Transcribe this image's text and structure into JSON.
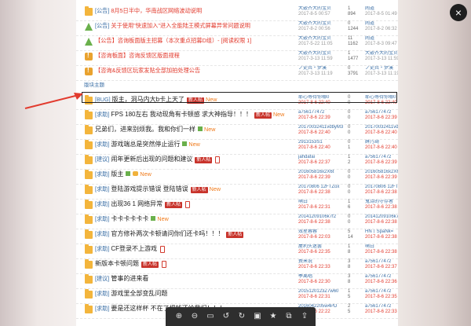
{
  "viewer": {
    "close_label": "×",
    "toolbar_icons": [
      "zoom-in-icon",
      "zoom-out-icon",
      "fit-icon",
      "rotate-left-icon",
      "rotate-right-icon",
      "save-icon",
      "bookmark-icon",
      "copy-icon",
      "share-icon"
    ]
  },
  "forum": {
    "section_label": "版块主题",
    "pinned": [
      {
        "cat": "[公告]",
        "title": "8月5日半中，华南战区网络波动说明",
        "red": true,
        "icon": "folder",
        "author": "大嵌齐大的宝贝",
        "adate": "2017-8-5 00:57",
        "replies": "1",
        "views": "894",
        "last": "闹道",
        "ldate": "2017-8-5 01:49"
      },
      {
        "cat": "[公告]",
        "title": "关于使用\"快速加入\"进入全能陆王模式屏幕异常问题说明",
        "red": true,
        "icon": "up",
        "author": "大嵌齐大的宝贝",
        "adate": "2017-8-2 00:56",
        "replies": "0",
        "views": "1244",
        "last": "闹道",
        "ldate": "2017-8-2 06:32"
      },
      {
        "cat": "",
        "title": "【公告】咨询板面版主招募（本次重点招募D组）- [阅读权限 1]",
        "red": true,
        "icon": "up",
        "author": "大嵌齐大的宝贝",
        "adate": "2017-5-22 11:05",
        "replies": "11",
        "views": "1162",
        "last": "闹道",
        "ldate": "2017-8-3 09:47"
      },
      {
        "cat": "",
        "title": "【咨询板面】咨询反馈区版面规程",
        "red": true,
        "icon": "pin",
        "author": "大嵌齐大的宝贝",
        "adate": "2017-3-13 11:59",
        "replies": "1",
        "views": "1477",
        "last": "大嵌齐大的宝贝",
        "ldate": "2017-3-13 11:59"
      },
      {
        "cat": "",
        "title": "【咨询&反馈区玩家发贴全部加拍处理公告",
        "red": true,
        "icon": "pin",
        "author": "ノ史兵・梦溪",
        "adate": "2017-3-13 11:19",
        "replies": "0",
        "views": "3791",
        "last": "ノ史兵・梦溪",
        "ldate": "2017-3-13 11:19"
      }
    ],
    "threads": [
      {
        "cat": "[BUG]",
        "title": "版主，洞马内大b卡上天了",
        "hot": "新人帖",
        "img": false,
        "new": "New",
        "author": "耶心等待你哪0",
        "adate": "2017-8-6 22:40",
        "replies": "0",
        "views": "0",
        "last": "耶心等待你哪0",
        "ldate": "2017-8-6 22:40"
      },
      {
        "cat": "[求助]",
        "title": "FPS 180左右 我动现角有卡顿感 求大神指导！！！",
        "hot": "新人帖",
        "img": false,
        "new": "New",
        "author": "a756177472",
        "adate": "2017-8-6 22:39",
        "replies": "0",
        "views": "0",
        "last": "a756177472",
        "ldate": "2017-8-6 22:39"
      },
      {
        "cat": "",
        "title": "兄弟们，进来别烦我。我和你们一样",
        "hot": "",
        "img": true,
        "new": "New",
        "author": "20170032411vdbyM3",
        "adate": "2017-8-6 22:40",
        "replies": "0",
        "views": "0",
        "last": "20170032411vdbyM3",
        "ldate": "2017-8-6 22:40"
      },
      {
        "cat": "[求助]",
        "title": "游戏端总是突然停止运行",
        "hot": "",
        "img": true,
        "new": "New",
        "author": "2913153S1",
        "adate": "2017-8-6 22:40",
        "replies": "0",
        "views": "1",
        "last": "薛乃琦",
        "ldate": "2017-8-6 22:40"
      },
      {
        "cat": "[建议]",
        "title": "闹年更新后出现的问题和建议",
        "hot": "新人帖",
        "img": false,
        "phone": true,
        "new": "",
        "author": "jahdafai",
        "adate": "2017-8-6 22:37",
        "replies": "1",
        "views": "2",
        "last": "a756177472",
        "ldate": "2017-8-6 22:39"
      },
      {
        "cat": "[求助]",
        "title": "版主",
        "hot": "",
        "img": true,
        "att": true,
        "new": "New",
        "author": "201605816x2X6t",
        "adate": "2017-8-6 22:39",
        "replies": "0",
        "views": "0",
        "last": "201605816x2X6t",
        "ldate": "2017-8-6 22:39"
      },
      {
        "cat": "[求助]",
        "title": "登陆游戏提示错误 登陆错误",
        "hot": "新人帖",
        "img": false,
        "new": "New",
        "author": "20170806 12FTZox",
        "adate": "2017-8-6 22:38",
        "replies": "0",
        "views": "0",
        "last": "20170806 12FTZox",
        "ldate": "2017-8-6 22:38"
      },
      {
        "cat": "[求助]",
        "title": "出现36 1 网络异常",
        "hot": "新人帖",
        "img": false,
        "phone": true,
        "new": "",
        "author": "萌白",
        "adate": "2017-8-6 22:31",
        "replies": "1",
        "views": "6",
        "last": "鬼诗的守存者",
        "ldate": "2017-8-6 22:38"
      },
      {
        "cat": "[求助]",
        "title": "卡卡卡卡卡卡",
        "hot": "",
        "img": true,
        "new": "New",
        "author": "20141209106k7f2",
        "adate": "2017-8-6 22:38",
        "replies": "0",
        "views": "0",
        "last": "20141209106k7f2",
        "ldate": "2017-8-6 22:38"
      },
      {
        "cat": "[求助]",
        "title": "官方修补两次卡顿请问你们还卡吗！！！",
        "hot": "新人帖",
        "img": false,
        "new": "",
        "author": "效星蓉蓉",
        "adate": "2017-8-6 22:03",
        "replies": "5",
        "views": "14",
        "last": "HN丨SpaNk=",
        "ldate": "2017-8-6 22:38"
      },
      {
        "cat": "[求助]",
        "title": "CF登录不上游戏",
        "hot": "",
        "img": false,
        "phone": true,
        "new": "",
        "author": "屋利头迷罢",
        "adate": "2017-8-6 22:35",
        "replies": "1",
        "views": "8",
        "last": "萌白",
        "ldate": "2017-8-6 22:38"
      },
      {
        "cat": "",
        "title": "新版本卡顿问题",
        "hot": "新人帖",
        "img": false,
        "phone": true,
        "new": "",
        "author": "费米说",
        "adate": "2017-8-6 22:33",
        "replies": "3",
        "views": "8",
        "last": "a756177472",
        "ldate": "2017-8-6 22:37"
      },
      {
        "cat": "[建议]",
        "title": "管事的进来看",
        "hot": "",
        "img": false,
        "new": "",
        "author": "季离唱",
        "adate": "2017-8-6 22:30",
        "replies": "3",
        "views": "8",
        "last": "a756177472",
        "ldate": "2017-8-6 22:36"
      },
      {
        "cat": "[求助]",
        "title": "游戏里全部变乱问题",
        "hot": "",
        "img": false,
        "new": "",
        "author": "2015120123Z7w60",
        "adate": "2017-8-6 22:31",
        "replies": "1",
        "views": "5",
        "last": "a756177472",
        "ldate": "2017-8-6 22:35"
      },
      {
        "cat": "[求助]",
        "title": "要是还这样杯 不在了把钱还给我们！！！",
        "hot": "",
        "img": false,
        "new": "",
        "author": "2016042205w4PD",
        "adate": "2017-8-6 22:22",
        "replies": "2",
        "views": "5",
        "last": "a756177472",
        "ldate": "2017-8-6 22:33"
      }
    ]
  }
}
